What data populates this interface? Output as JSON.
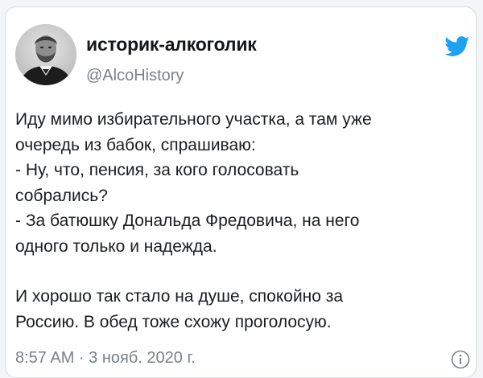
{
  "tweet": {
    "author": {
      "name": "историк-алкоголик",
      "handle": "@AlcoHistory",
      "avatar_icon": "portrait-avatar"
    },
    "platform_icon": "twitter-bird-icon",
    "brand_color": "#1da1f2",
    "lines": [
      "Иду мимо избирательного участка, а там уже",
      "очередь из бабок, спрашиваю:",
      "- Ну, что, пенсия, за кого голосовать",
      "собрались?",
      "- За батюшку Дональда Фредовича, на него",
      "одного только и надежда."
    ],
    "lines2": [
      "И хорошо так стало на душе, спокойно за",
      "Россию. В обед тоже схожу проголосую."
    ],
    "timestamp": "8:57 AM · 3 нояб. 2020 г.",
    "info_icon": "info-icon"
  }
}
